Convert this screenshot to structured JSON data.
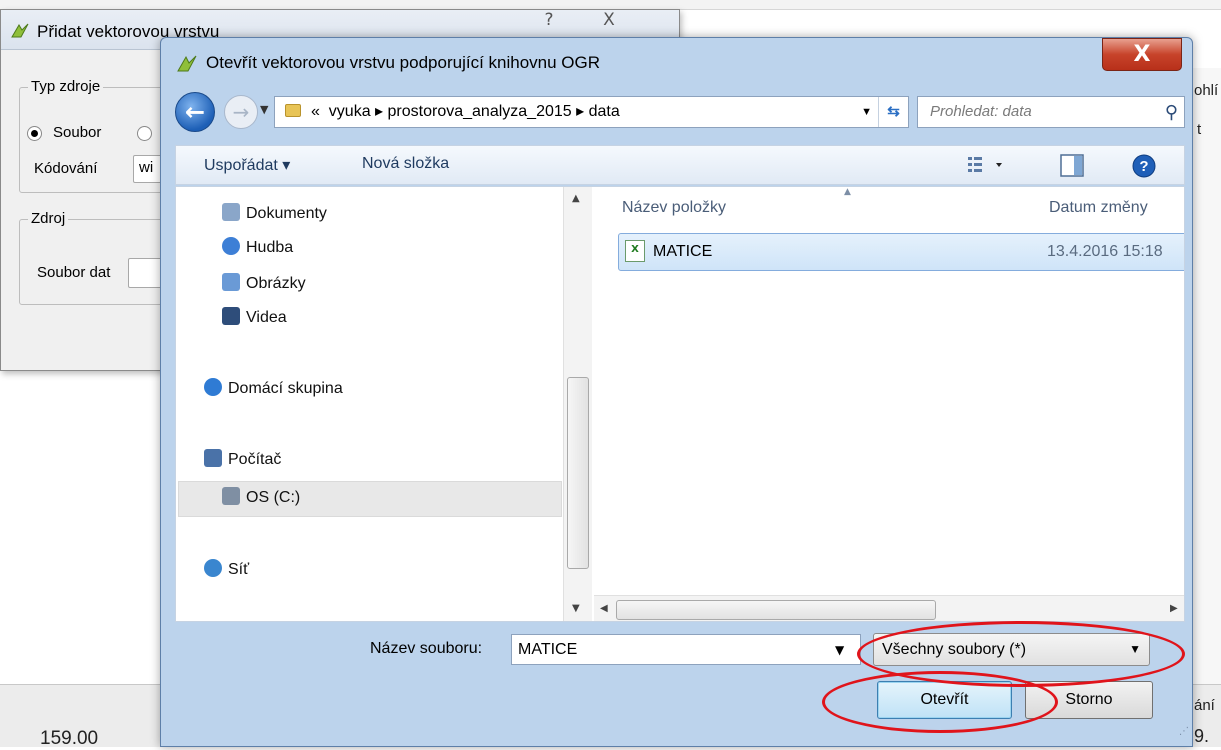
{
  "background": {
    "top_left_number": "159.00",
    "right_fragments": [
      "ohlí",
      "t",
      "ání",
      "9."
    ]
  },
  "add_dialog": {
    "title": "Přidat vektorovou vrstvu",
    "help_glyph": "?",
    "close_glyph": "X",
    "source_type_group": "Typ zdroje",
    "radio_file": "Soubor",
    "encoding_label": "Kódování",
    "encoding_value": "wi",
    "source_group": "Zdroj",
    "dataset_label": "Soubor dat"
  },
  "ogr_dialog": {
    "title": "Otevřít vektorovou vrstvu podporující knihovnu OGR",
    "close_glyph": "X",
    "address": {
      "prefix": "«",
      "crumbs": [
        "vyuka",
        "prostorova_analyza_2015",
        "data"
      ],
      "separator": "▸"
    },
    "search_placeholder": "Prohledat: data",
    "toolbar": {
      "organize": "Uspořádat ▾",
      "new_folder": "Nová složka"
    },
    "nav_items": [
      {
        "label": "Dokumenty",
        "icon": "documents-icon",
        "color": "#8aa6c9"
      },
      {
        "label": "Hudba",
        "icon": "music-icon",
        "color": "#3d7fd6"
      },
      {
        "label": "Obrázky",
        "icon": "pictures-icon",
        "color": "#6a9ad6"
      },
      {
        "label": "Videa",
        "icon": "videos-icon",
        "color": "#2e4d7a"
      },
      {
        "label": "Domácí skupina",
        "icon": "homegroup-icon",
        "color": "#2f7bd4"
      },
      {
        "label": "Počítač",
        "icon": "computer-icon",
        "color": "#4a72a8"
      },
      {
        "label": "OS (C:)",
        "icon": "drive-icon",
        "color": "#7f8fa3"
      },
      {
        "label": "Síť",
        "icon": "network-icon",
        "color": "#3a86cf"
      }
    ],
    "columns": {
      "name": "Název položky",
      "date": "Datum změny"
    },
    "files": [
      {
        "name": "MATICE",
        "date": "13.4.2016 15:18"
      }
    ],
    "filename_label": "Název souboru:",
    "filename_value": "MATICE",
    "filter_value": "Všechny soubory (*)",
    "open_button": "Otevřít",
    "cancel_button": "Storno"
  },
  "colors": {
    "annotation_red": "#e0141b",
    "selection_blue": "#cfe4f8"
  }
}
